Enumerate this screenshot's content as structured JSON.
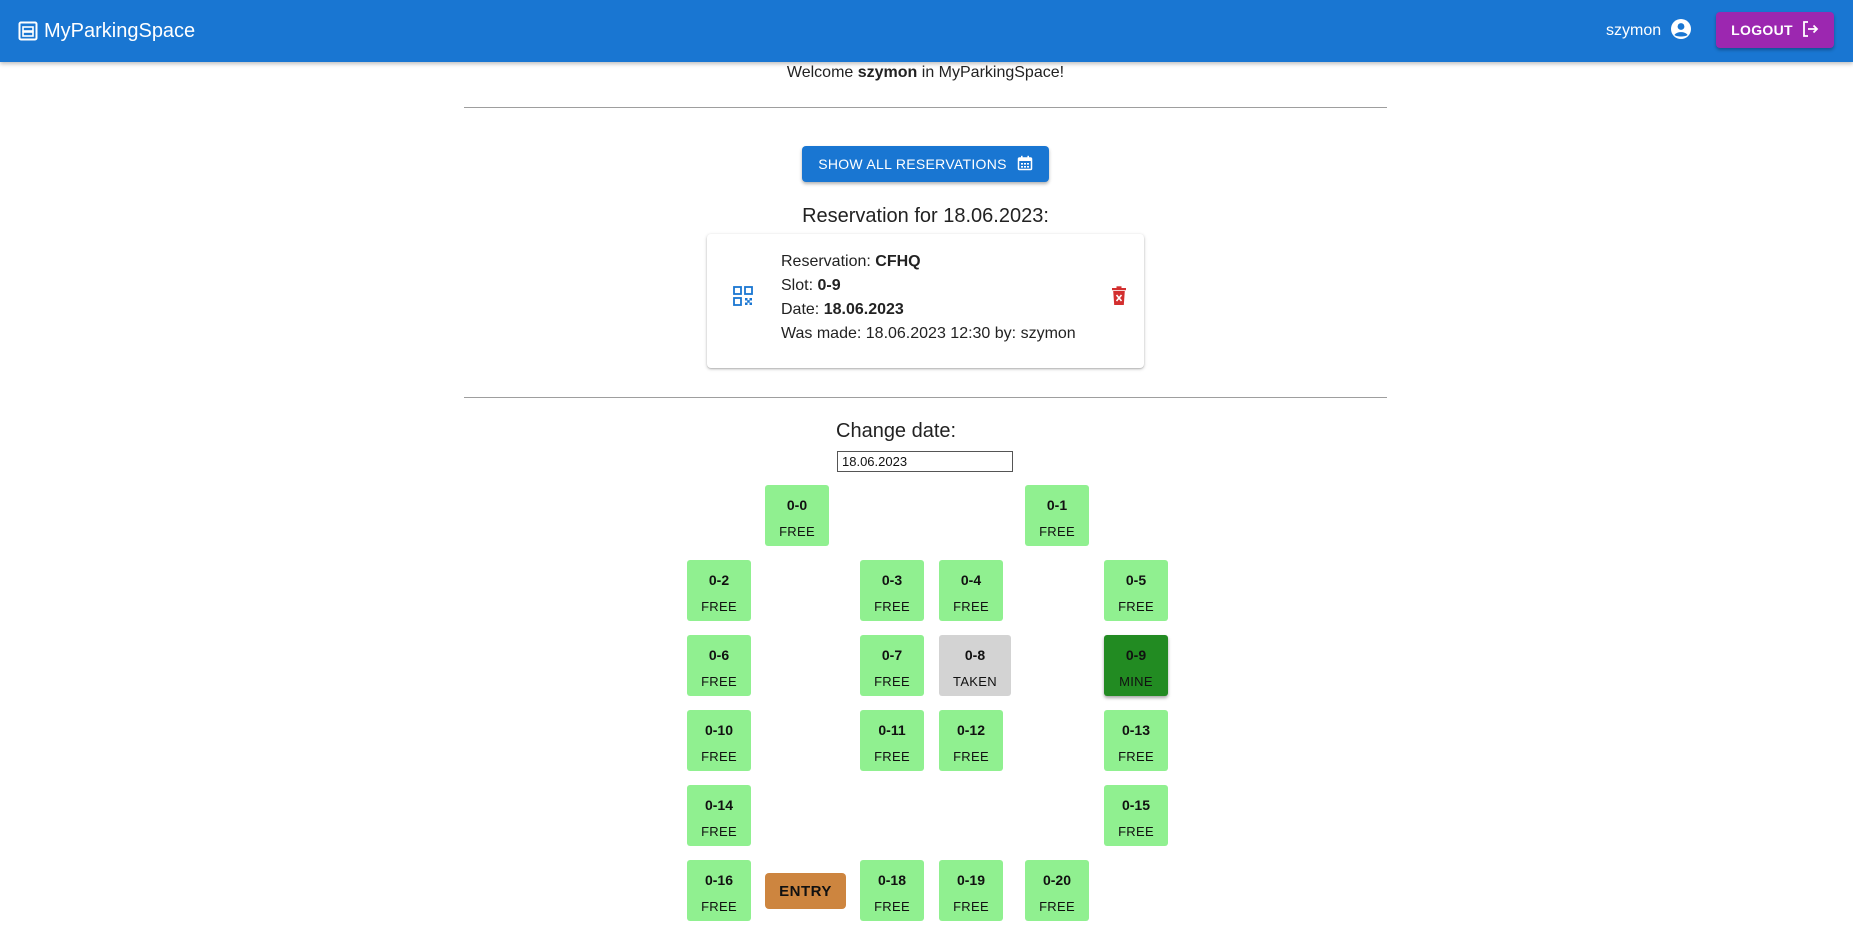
{
  "app": {
    "title": "MyParkingSpace"
  },
  "header": {
    "username": "szymon",
    "logout_label": "LOGOUT"
  },
  "welcome": {
    "prefix": "Welcome",
    "username": "szymon",
    "suffix": "in MyParkingSpace!"
  },
  "actions": {
    "show_all_label": "SHOW ALL RESERVATIONS"
  },
  "reservation": {
    "heading": "Reservation for 18.06.2023:",
    "code_label": "Reservation:",
    "code": "CFHQ",
    "slot_label": "Slot:",
    "slot": "0-9",
    "date_label": "Date:",
    "date": "18.06.2023",
    "made_text": "Was made: 18.06.2023 12:30 by: szymon"
  },
  "date_picker": {
    "label": "Change date:",
    "value": "18.06.2023"
  },
  "parking": {
    "colors": {
      "free": "#90f090",
      "taken": "#d3d3d3",
      "mine": "#228b22",
      "entry": "#cd853f"
    },
    "slots": [
      {
        "id": "0-0",
        "status": "FREE"
      },
      {
        "id": "0-1",
        "status": "FREE"
      },
      {
        "id": "0-2",
        "status": "FREE"
      },
      {
        "id": "0-3",
        "status": "FREE"
      },
      {
        "id": "0-4",
        "status": "FREE"
      },
      {
        "id": "0-5",
        "status": "FREE"
      },
      {
        "id": "0-6",
        "status": "FREE"
      },
      {
        "id": "0-7",
        "status": "FREE"
      },
      {
        "id": "0-8",
        "status": "TAKEN"
      },
      {
        "id": "0-9",
        "status": "MINE"
      },
      {
        "id": "0-10",
        "status": "FREE"
      },
      {
        "id": "0-11",
        "status": "FREE"
      },
      {
        "id": "0-12",
        "status": "FREE"
      },
      {
        "id": "0-13",
        "status": "FREE"
      },
      {
        "id": "0-14",
        "status": "FREE"
      },
      {
        "id": "0-15",
        "status": "FREE"
      },
      {
        "id": "0-16",
        "status": "FREE"
      },
      {
        "id": "0-18",
        "status": "FREE"
      },
      {
        "id": "0-19",
        "status": "FREE"
      },
      {
        "id": "0-20",
        "status": "FREE"
      }
    ],
    "entry_label": "ENTRY"
  }
}
